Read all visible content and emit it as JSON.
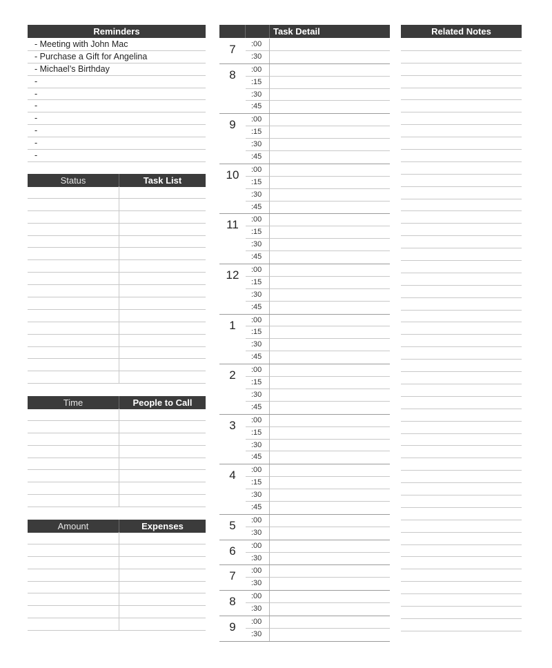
{
  "reminders": {
    "title": "Reminders",
    "items": [
      "- Meeting with John Mac",
      "- Purchase a Gift for Angelina",
      "- Michael’s Birthday",
      "-",
      "-",
      "-",
      "-",
      "-",
      "-",
      "-"
    ]
  },
  "task_list": {
    "col1": "Status",
    "col2": "Task List",
    "row_count": 16
  },
  "people_to_call": {
    "col1": "Time",
    "col2": "People to Call",
    "row_count": 8
  },
  "expenses": {
    "col1": "Amount",
    "col2": "Expenses",
    "row_count": 8
  },
  "task_detail": {
    "title": "Task Detail",
    "hours": [
      {
        "hour": "7",
        "slots": [
          ":00",
          ":30"
        ]
      },
      {
        "hour": "8",
        "slots": [
          ":00",
          ":15",
          ":30",
          ":45"
        ]
      },
      {
        "hour": "9",
        "slots": [
          ":00",
          ":15",
          ":30",
          ":45"
        ]
      },
      {
        "hour": "10",
        "slots": [
          ":00",
          ":15",
          ":30",
          ":45"
        ]
      },
      {
        "hour": "11",
        "slots": [
          ":00",
          ":15",
          ":30",
          ":45"
        ]
      },
      {
        "hour": "12",
        "slots": [
          ":00",
          ":15",
          ":30",
          ":45"
        ]
      },
      {
        "hour": "1",
        "slots": [
          ":00",
          ":15",
          ":30",
          ":45"
        ]
      },
      {
        "hour": "2",
        "slots": [
          ":00",
          ":15",
          ":30",
          ":45"
        ]
      },
      {
        "hour": "3",
        "slots": [
          ":00",
          ":15",
          ":30",
          ":45"
        ]
      },
      {
        "hour": "4",
        "slots": [
          ":00",
          ":15",
          ":30",
          ":45"
        ]
      },
      {
        "hour": "5",
        "slots": [
          ":00",
          ":30"
        ]
      },
      {
        "hour": "6",
        "slots": [
          ":00",
          ":30"
        ]
      },
      {
        "hour": "7",
        "slots": [
          ":00",
          ":30"
        ]
      },
      {
        "hour": "8",
        "slots": [
          ":00",
          ":30"
        ]
      },
      {
        "hour": "9",
        "slots": [
          ":00",
          ":30"
        ]
      }
    ]
  },
  "related_notes": {
    "title": "Related Notes",
    "row_count": 48
  }
}
